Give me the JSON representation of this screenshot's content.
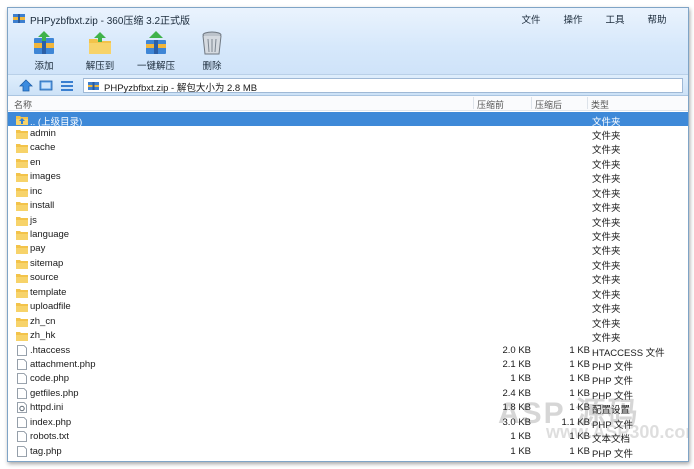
{
  "window": {
    "title": "PHPyzbfbxt.zip - 360压缩 3.2正式版",
    "menu": [
      "文件",
      "操作",
      "工具",
      "帮助"
    ]
  },
  "toolbar": {
    "add_label": "添加",
    "extract_to_label": "解压到",
    "one_click_label": "一键解压",
    "delete_label": "删除"
  },
  "address": {
    "text": "PHPyzbfbxt.zip - 解包大小为 2.8 MB"
  },
  "columns": {
    "name": "名称",
    "size": "压缩前",
    "compressed": "压缩后",
    "type": "类型"
  },
  "colors": {
    "selection": "#3e89d8",
    "folder": "#f3c34a"
  },
  "files": [
    {
      "icon": "up-folder-icon",
      "name": ".. (上级目录)",
      "size": "",
      "compressed": "",
      "type": "文件夹",
      "selected": true
    },
    {
      "icon": "folder-icon",
      "name": "admin",
      "size": "",
      "compressed": "",
      "type": "文件夹"
    },
    {
      "icon": "folder-icon",
      "name": "cache",
      "size": "",
      "compressed": "",
      "type": "文件夹"
    },
    {
      "icon": "folder-icon",
      "name": "en",
      "size": "",
      "compressed": "",
      "type": "文件夹"
    },
    {
      "icon": "folder-icon",
      "name": "images",
      "size": "",
      "compressed": "",
      "type": "文件夹"
    },
    {
      "icon": "folder-icon",
      "name": "inc",
      "size": "",
      "compressed": "",
      "type": "文件夹"
    },
    {
      "icon": "folder-icon",
      "name": "install",
      "size": "",
      "compressed": "",
      "type": "文件夹"
    },
    {
      "icon": "folder-icon",
      "name": "js",
      "size": "",
      "compressed": "",
      "type": "文件夹"
    },
    {
      "icon": "folder-icon",
      "name": "language",
      "size": "",
      "compressed": "",
      "type": "文件夹"
    },
    {
      "icon": "folder-icon",
      "name": "pay",
      "size": "",
      "compressed": "",
      "type": "文件夹"
    },
    {
      "icon": "folder-icon",
      "name": "sitemap",
      "size": "",
      "compressed": "",
      "type": "文件夹"
    },
    {
      "icon": "folder-icon",
      "name": "source",
      "size": "",
      "compressed": "",
      "type": "文件夹"
    },
    {
      "icon": "folder-icon",
      "name": "template",
      "size": "",
      "compressed": "",
      "type": "文件夹"
    },
    {
      "icon": "folder-icon",
      "name": "uploadfile",
      "size": "",
      "compressed": "",
      "type": "文件夹"
    },
    {
      "icon": "folder-icon",
      "name": "zh_cn",
      "size": "",
      "compressed": "",
      "type": "文件夹"
    },
    {
      "icon": "folder-icon",
      "name": "zh_hk",
      "size": "",
      "compressed": "",
      "type": "文件夹"
    },
    {
      "icon": "file-icon",
      "name": ".htaccess",
      "size": "2.0 KB",
      "compressed": "1 KB",
      "type": "HTACCESS 文件"
    },
    {
      "icon": "file-icon",
      "name": "attachment.php",
      "size": "2.1 KB",
      "compressed": "1 KB",
      "type": "PHP 文件"
    },
    {
      "icon": "file-icon",
      "name": "code.php",
      "size": "1 KB",
      "compressed": "1 KB",
      "type": "PHP 文件"
    },
    {
      "icon": "file-icon",
      "name": "getfiles.php",
      "size": "2.4 KB",
      "compressed": "1 KB",
      "type": "PHP 文件"
    },
    {
      "icon": "settings-file-icon",
      "name": "httpd.ini",
      "size": "1.8 KB",
      "compressed": "1 KB",
      "type": "配置设置"
    },
    {
      "icon": "file-icon",
      "name": "index.php",
      "size": "3.0 KB",
      "compressed": "1.1 KB",
      "type": "PHP 文件"
    },
    {
      "icon": "file-icon",
      "name": "robots.txt",
      "size": "1 KB",
      "compressed": "1 KB",
      "type": "文本文档"
    },
    {
      "icon": "file-icon",
      "name": "tag.php",
      "size": "1 KB",
      "compressed": "1 KB",
      "type": "PHP 文件"
    }
  ]
}
